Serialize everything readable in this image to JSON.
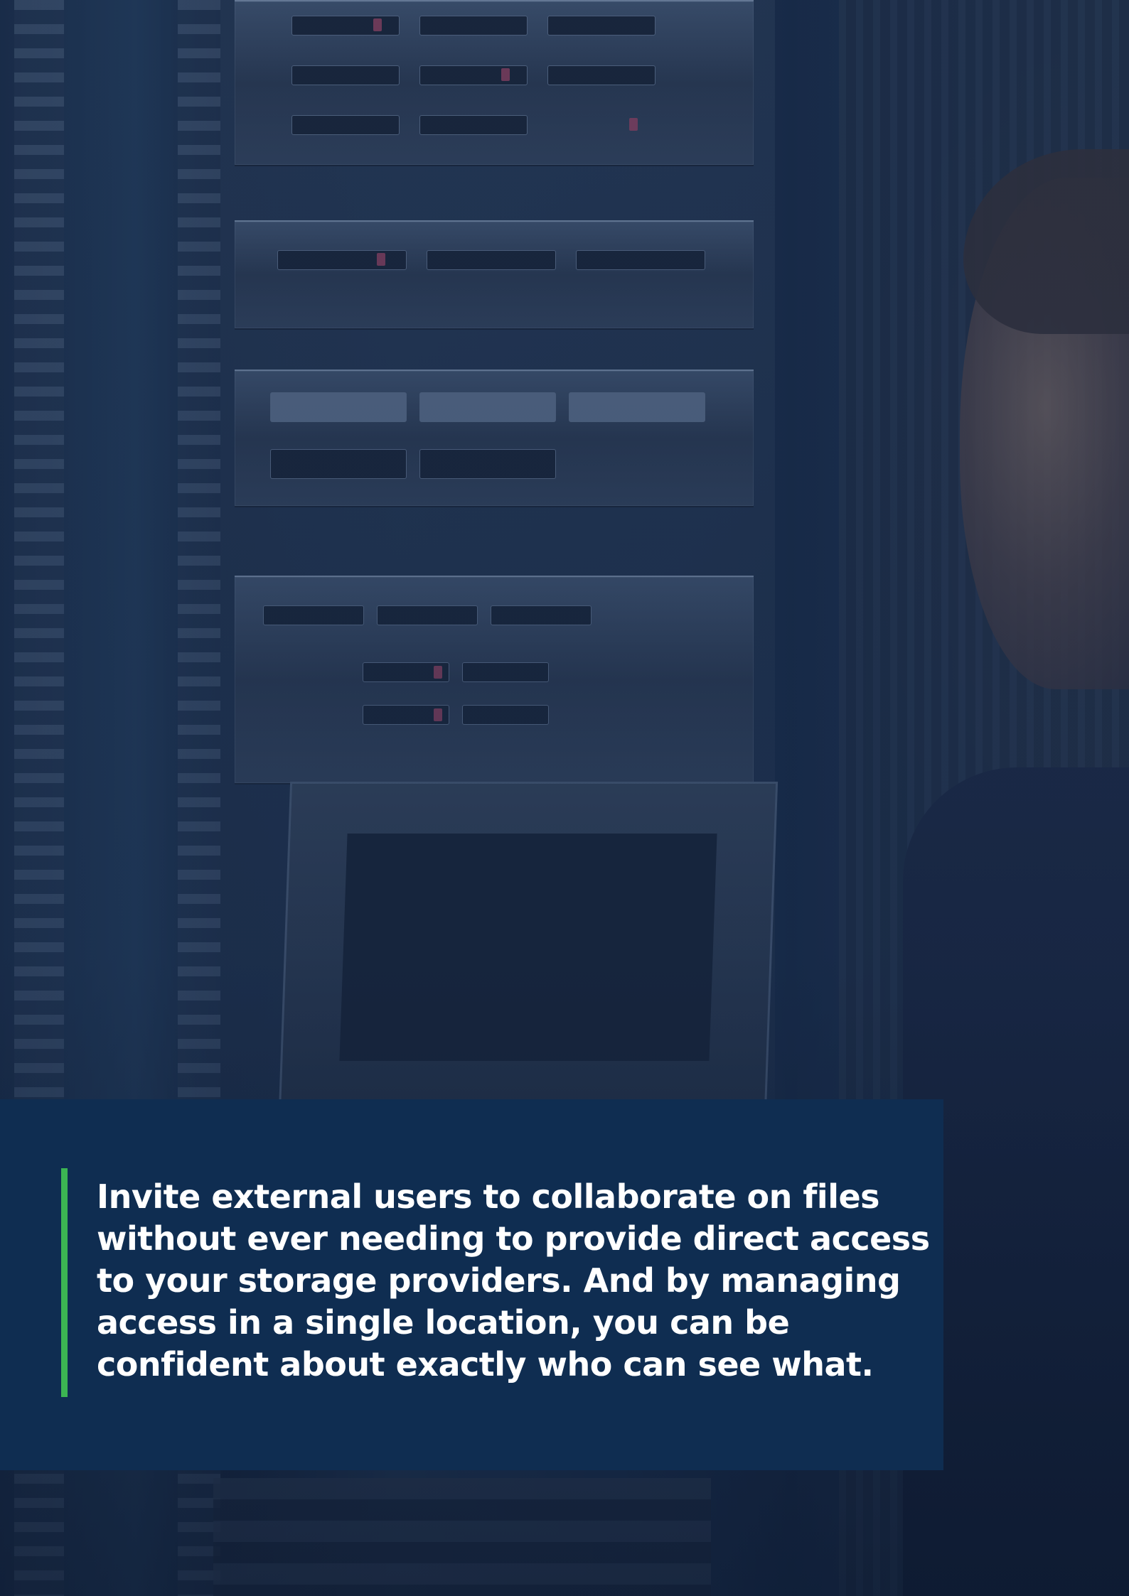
{
  "quote": {
    "lines": [
      "Invite external users to collaborate on files",
      "without ever needing to provide direct access",
      "to your storage providers. And by managing",
      "access in a single location, you can be",
      "confident about exactly who can see what."
    ],
    "accent_color": "#3cb553",
    "panel_color": "#0f2d51"
  }
}
